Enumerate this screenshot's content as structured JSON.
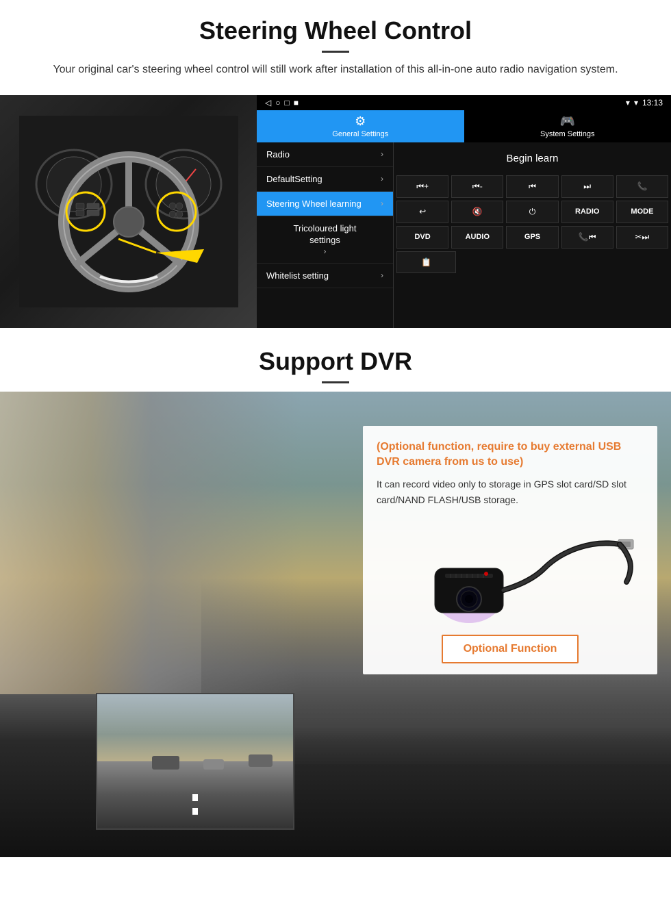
{
  "steering_section": {
    "title": "Steering Wheel Control",
    "description": "Your original car's steering wheel control will still work after installation of this all-in-one auto radio navigation system.",
    "status_bar": {
      "time": "13:13",
      "signal": "▼",
      "wifi": "▾"
    },
    "nav_icons": [
      "◁",
      "○",
      "□",
      "■"
    ],
    "tabs": [
      {
        "id": "general",
        "icon": "⚙",
        "label": "General Settings",
        "active": true
      },
      {
        "id": "system",
        "icon": "🎮",
        "label": "System Settings",
        "active": false
      }
    ],
    "menu_items": [
      {
        "label": "Radio",
        "active": false,
        "has_chevron": true
      },
      {
        "label": "DefaultSetting",
        "active": false,
        "has_chevron": true
      },
      {
        "label": "Steering Wheel learning",
        "active": true,
        "has_chevron": true
      },
      {
        "label": "Tricoloured light settings",
        "active": false,
        "has_chevron": true,
        "center": true
      },
      {
        "label": "Whitelist setting",
        "active": false,
        "has_chevron": true
      }
    ],
    "begin_learn": "Begin learn",
    "control_buttons_row1": [
      "⏮+",
      "⏮-",
      "⏮⏮",
      "⏭⏭",
      "📞"
    ],
    "control_buttons_row2": [
      "↩",
      "🔇",
      "⏻",
      "RADIO",
      "MODE"
    ],
    "control_buttons_row3": [
      "DVD",
      "AUDIO",
      "GPS",
      "📞⏮",
      "✂⏭"
    ],
    "control_buttons_row4": [
      "📋"
    ]
  },
  "dvr_section": {
    "title": "Support DVR",
    "optional_title": "(Optional function, require to buy external USB DVR camera from us to use)",
    "description": "It can record video only to storage in GPS slot card/SD slot card/NAND FLASH/USB storage.",
    "optional_function_label": "Optional Function"
  }
}
